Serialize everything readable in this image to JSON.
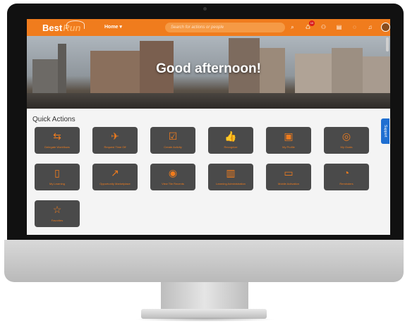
{
  "header": {
    "logo_best": "Best",
    "logo_run": "Run",
    "home_label": "Home ▾",
    "search_placeholder": "Search for actions or people",
    "notification_count": "10"
  },
  "hero": {
    "greeting": "Good afternoon!"
  },
  "quick_actions": {
    "title": "Quick Actions",
    "items": [
      {
        "label": "Delegate Workflows",
        "icon": "calendar-arrow-icon",
        "glyph": "⇆"
      },
      {
        "label": "Request Time Off",
        "icon": "airplane-icon",
        "glyph": "✈"
      },
      {
        "label": "Create Activity",
        "icon": "clipboard-check-icon",
        "glyph": "☑"
      },
      {
        "label": "Recognize",
        "icon": "thumbs-up-icon",
        "glyph": "👍"
      },
      {
        "label": "My Profile",
        "icon": "id-card-icon",
        "glyph": "▣"
      },
      {
        "label": "My Goals",
        "icon": "target-icon",
        "glyph": "◎"
      },
      {
        "label": "My Learning",
        "icon": "book-icon",
        "glyph": "▯"
      },
      {
        "label": "Opportunity Marketplace",
        "icon": "growth-chart-icon",
        "glyph": "↗"
      },
      {
        "label": "View Tile Recents",
        "icon": "dial-icon",
        "glyph": "◉"
      },
      {
        "label": "Learning Administration",
        "icon": "open-book-icon",
        "glyph": "▥"
      },
      {
        "label": "Mobile Activation",
        "icon": "devices-icon",
        "glyph": "▭"
      },
      {
        "label": "Reminders",
        "icon": "timer-icon",
        "glyph": "◔"
      },
      {
        "label": "Favorites",
        "icon": "star-list-icon",
        "glyph": "☆"
      }
    ]
  },
  "support": {
    "label": "Support"
  },
  "colors": {
    "brand": "#f07c1d",
    "tile": "#4a4a4a",
    "support": "#1f6fd1"
  }
}
